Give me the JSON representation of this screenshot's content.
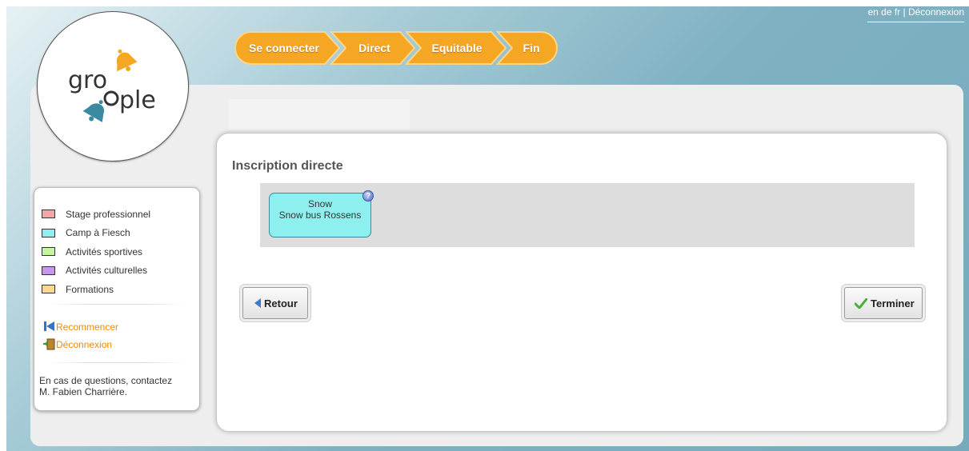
{
  "header": {
    "top_links": "en de fr | Déconnexion"
  },
  "logo": {
    "text_top": "gro",
    "text_bottom": "ple"
  },
  "steps": [
    {
      "label": "Se connecter"
    },
    {
      "label": "Direct"
    },
    {
      "label": "Equitable"
    },
    {
      "label": "Fin"
    }
  ],
  "colors": {
    "step_orange": "#f5a623",
    "accent_link": "#f08c00",
    "activity_cyan": "#8ef0ee"
  },
  "legend": [
    {
      "label": "Stage professionnel",
      "color": "#f4a6a6"
    },
    {
      "label": "Camp à Fiesch",
      "color": "#8ef0ee"
    },
    {
      "label": "Activités sportives",
      "color": "#c6f5a0"
    },
    {
      "label": "Activités culturelles",
      "color": "#c896f0"
    },
    {
      "label": "Formations",
      "color": "#fcd98a"
    }
  ],
  "sidebar": {
    "restart_label": "Recommencer",
    "restart_icon": "skip-back-icon",
    "logout_label": "Déconnexion",
    "logout_icon": "exit-door-icon",
    "contact_line1": "En cas de questions, contactez",
    "contact_line2": "M. Fabien Charrière."
  },
  "content": {
    "title": "Inscription directe",
    "activity": {
      "line1": "Snow",
      "line2": "Snow bus Rossens",
      "help_glyph": "?"
    },
    "back_label": "Retour",
    "back_icon": "arrow-left-icon",
    "finish_label": "Terminer",
    "finish_icon": "checkmark-icon"
  }
}
